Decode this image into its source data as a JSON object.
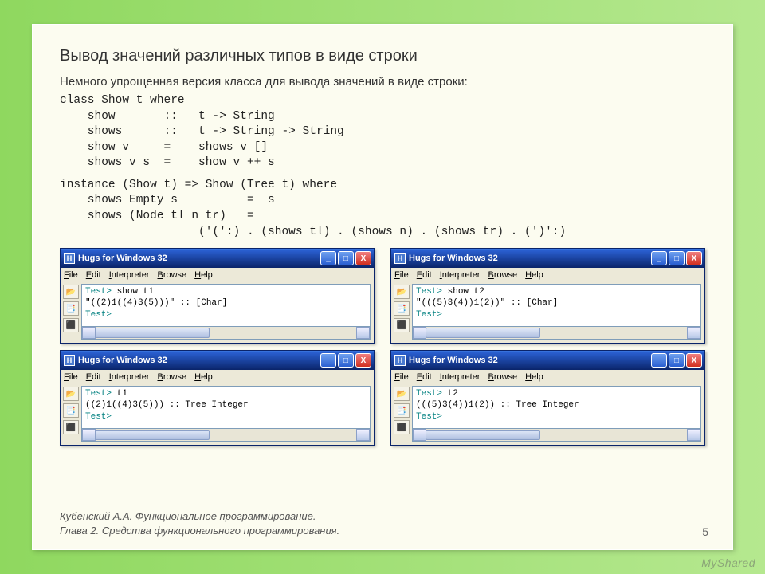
{
  "slide": {
    "title": "Вывод значений различных типов в виде строки",
    "subtitle": "Немного упрощенная версия класса для вывода значений в виде строки:",
    "code1": "class Show t where\n    show       ::   t -> String\n    shows      ::   t -> String -> String\n    show v     =    shows v []\n    shows v s  =    show v ++ s",
    "code2": "instance (Show t) => Show (Tree t) where\n    shows Empty s          =  s\n    shows (Node tl n tr)   =\n                    ('(':) . (shows tl) . (shows n) . (shows tr) . (')':)"
  },
  "windows": {
    "title": "Hugs for Windows 32",
    "menus": {
      "file": "File",
      "edit": "Edit",
      "interpreter": "Interpreter",
      "browse": "Browse",
      "help": "Help"
    },
    "buttons": {
      "min": "_",
      "max": "□",
      "close": "X"
    },
    "toolbar": {
      "open": "📂",
      "scripts": "📑",
      "stop": "⬛"
    },
    "sessions": [
      {
        "line1_prompt": "Test>",
        "line1_cmd": " show t1",
        "line2": "\"((2)1((4)3(5)))\" :: [Char]",
        "line3_prompt": "Test>"
      },
      {
        "line1_prompt": "Test>",
        "line1_cmd": " show t2",
        "line2": "\"(((5)3(4))1(2))\" :: [Char]",
        "line3_prompt": "Test>"
      },
      {
        "line1_prompt": "Test>",
        "line1_cmd": " t1",
        "line2": "((2)1((4)3(5))) :: Tree Integer",
        "line3_prompt": "Test>"
      },
      {
        "line1_prompt": "Test>",
        "line1_cmd": " t2",
        "line2": "(((5)3(4))1(2)) :: Tree Integer",
        "line3_prompt": "Test>"
      }
    ]
  },
  "footer": {
    "line1": "Кубенский А.А. Функциональное программирование.",
    "line2": "Глава 2. Средства функционального программирования."
  },
  "page": "5",
  "watermark": "MyShared"
}
